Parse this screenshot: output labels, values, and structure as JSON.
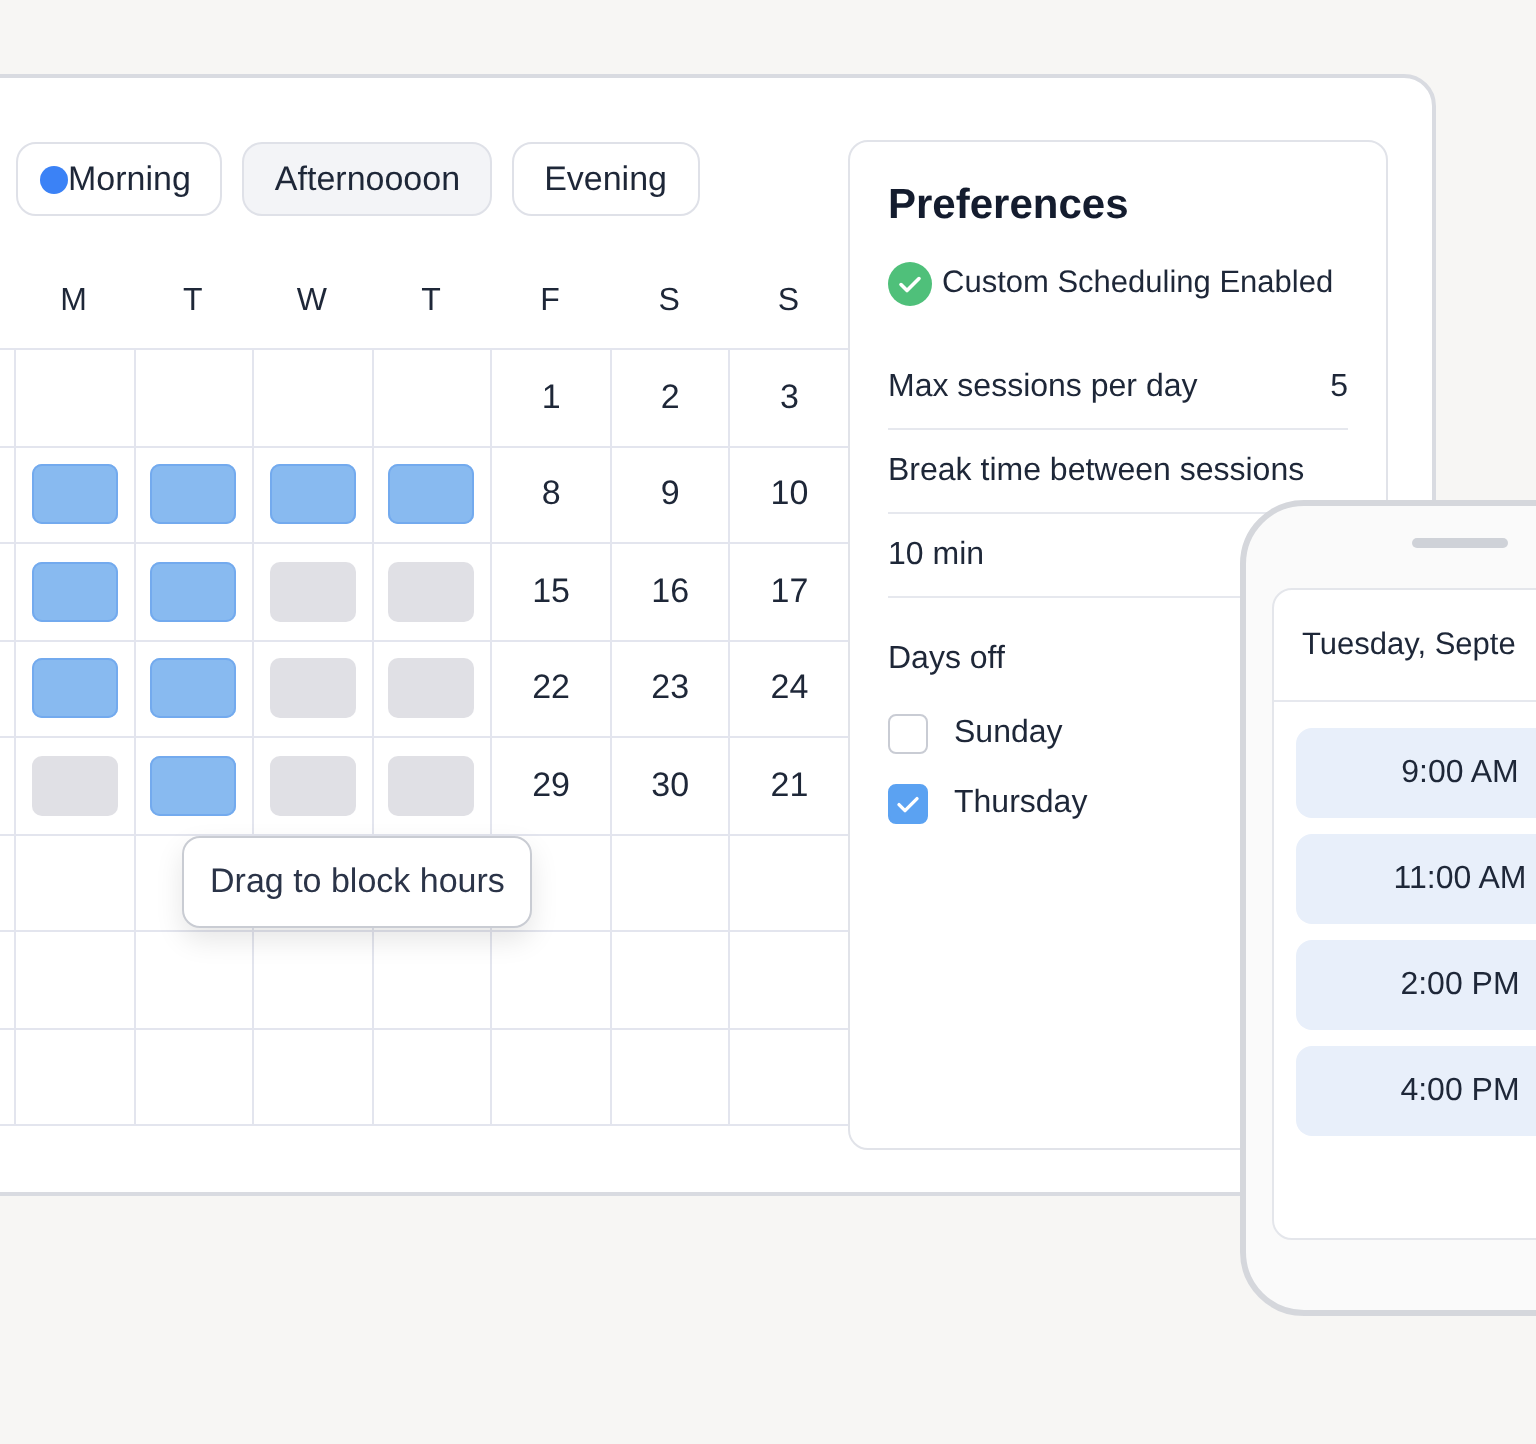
{
  "filters": [
    {
      "label": "Morning",
      "selected": true,
      "highlighted": false
    },
    {
      "label": "Afternoooon",
      "selected": false,
      "highlighted": true
    },
    {
      "label": "Evening",
      "selected": false,
      "highlighted": false
    }
  ],
  "calendar": {
    "weekdays": [
      "M",
      "T",
      "W",
      "T",
      "F",
      "S",
      "S"
    ],
    "weeks": [
      [
        {
          "kind": "empty"
        },
        {
          "kind": "empty"
        },
        {
          "kind": "empty"
        },
        {
          "kind": "empty"
        },
        {
          "kind": "date",
          "label": "1"
        },
        {
          "kind": "date",
          "label": "2"
        },
        {
          "kind": "date",
          "label": "3"
        }
      ],
      [
        {
          "kind": "slot",
          "blocked": true
        },
        {
          "kind": "slot",
          "blocked": true
        },
        {
          "kind": "slot",
          "blocked": true
        },
        {
          "kind": "slot",
          "blocked": true
        },
        {
          "kind": "date",
          "label": "8"
        },
        {
          "kind": "date",
          "label": "9"
        },
        {
          "kind": "date",
          "label": "10"
        }
      ],
      [
        {
          "kind": "slot",
          "blocked": true
        },
        {
          "kind": "slot",
          "blocked": true
        },
        {
          "kind": "slot",
          "blocked": false
        },
        {
          "kind": "slot",
          "blocked": false
        },
        {
          "kind": "date",
          "label": "15"
        },
        {
          "kind": "date",
          "label": "16"
        },
        {
          "kind": "date",
          "label": "17"
        }
      ],
      [
        {
          "kind": "slot",
          "blocked": true
        },
        {
          "kind": "slot",
          "blocked": true
        },
        {
          "kind": "slot",
          "blocked": false
        },
        {
          "kind": "slot",
          "blocked": false
        },
        {
          "kind": "date",
          "label": "22"
        },
        {
          "kind": "date",
          "label": "23"
        },
        {
          "kind": "date",
          "label": "24"
        }
      ],
      [
        {
          "kind": "slot",
          "blocked": false
        },
        {
          "kind": "slot",
          "blocked": true
        },
        {
          "kind": "slot",
          "blocked": false
        },
        {
          "kind": "slot",
          "blocked": false
        },
        {
          "kind": "date",
          "label": "29"
        },
        {
          "kind": "date",
          "label": "30"
        },
        {
          "kind": "date",
          "label": "21"
        }
      ],
      [
        {
          "kind": "empty"
        },
        {
          "kind": "empty"
        },
        {
          "kind": "empty"
        },
        {
          "kind": "empty"
        },
        {
          "kind": "empty"
        },
        {
          "kind": "empty"
        },
        {
          "kind": "empty"
        }
      ],
      [
        {
          "kind": "empty"
        },
        {
          "kind": "empty"
        },
        {
          "kind": "empty"
        },
        {
          "kind": "empty"
        },
        {
          "kind": "empty"
        },
        {
          "kind": "empty"
        },
        {
          "kind": "empty"
        }
      ],
      [
        {
          "kind": "empty"
        },
        {
          "kind": "empty"
        },
        {
          "kind": "empty"
        },
        {
          "kind": "empty"
        },
        {
          "kind": "empty"
        },
        {
          "kind": "empty"
        },
        {
          "kind": "empty"
        }
      ]
    ],
    "tooltip": "Drag to block hours"
  },
  "preferences": {
    "title": "Preferences",
    "status": {
      "label": "Custom Scheduling Enabled",
      "enabled": true
    },
    "settings": [
      {
        "kind": "inline",
        "label": "Max sessions per day",
        "value": "5"
      },
      {
        "kind": "stacked",
        "label": "Break time between sessions",
        "value": "10 min"
      }
    ],
    "days_off": {
      "label": "Days off",
      "options": [
        {
          "label": "Sunday",
          "checked": false
        },
        {
          "label": "Thursday",
          "checked": true
        }
      ]
    }
  },
  "phone": {
    "date": "Tuesday, Septe",
    "slots": [
      "9:00 AM",
      "11:00 AM",
      "2:00 PM",
      "4:00 PM"
    ]
  }
}
